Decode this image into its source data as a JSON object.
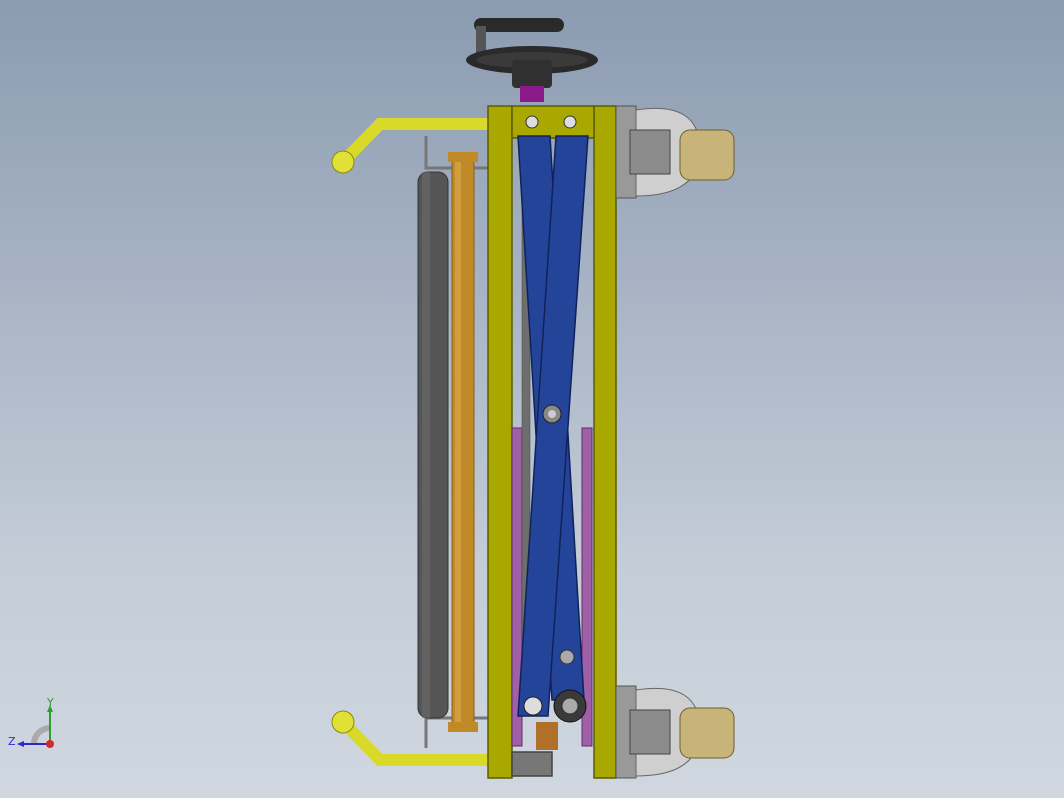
{
  "viewport": {
    "background_top": "#8b9bb0",
    "background_bottom": "#d0d7e0"
  },
  "model": {
    "frame_color": "#a8a800",
    "scissor_color": "#24449a",
    "guide_color": "#a060a8",
    "handle_color": "#d9d92a",
    "roller_dark_color": "#555555",
    "roller_orange_color": "#c08a28",
    "wheel_color": "#c8b478",
    "knob_color": "#2a2a2a"
  },
  "triad": {
    "x_label": "",
    "y_label": "Y",
    "z_label": "Z",
    "y_color": "#2aa02a",
    "z_color": "#2a2ad0",
    "x_color": "#d02a2a"
  }
}
